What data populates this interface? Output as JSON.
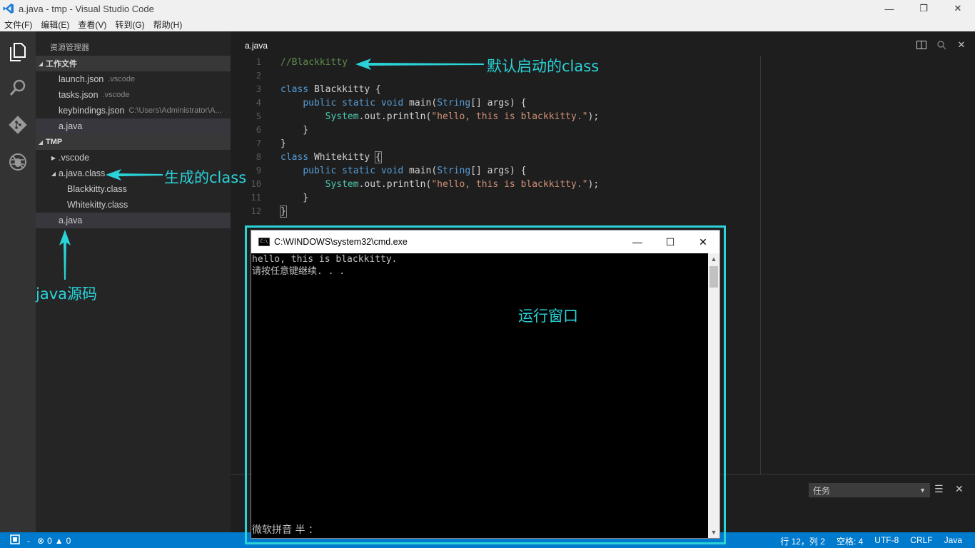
{
  "window": {
    "title": "a.java - tmp - Visual Studio Code",
    "controls": [
      "—",
      "❐",
      "✕"
    ]
  },
  "menu": [
    "文件(F)",
    "编辑(E)",
    "查看(V)",
    "转到(G)",
    "帮助(H)"
  ],
  "activity_icons": [
    "files-icon",
    "search-icon",
    "git-icon",
    "debug-icon"
  ],
  "sidebar": {
    "title": "资源管理器",
    "working_files_header": "工作文件",
    "working_files": [
      {
        "name": "launch.json",
        "detail": ".vscode"
      },
      {
        "name": "tasks.json",
        "detail": ".vscode"
      },
      {
        "name": "keybindings.json",
        "detail": "C:\\Users\\Administrator\\A..."
      },
      {
        "name": "a.java",
        "detail": ""
      }
    ],
    "folder_header": "TMP",
    "tree": [
      {
        "name": ".vscode",
        "level": 1,
        "twisty": "▶"
      },
      {
        "name": "a.java.class",
        "level": 1,
        "twisty": "◢"
      },
      {
        "name": "Blackkitty.class",
        "level": 2,
        "twisty": ""
      },
      {
        "name": "Whitekitty.class",
        "level": 2,
        "twisty": ""
      },
      {
        "name": "a.java",
        "level": 1,
        "twisty": ""
      }
    ]
  },
  "editor": {
    "tab": "a.java",
    "line_numbers": [
      "1",
      "2",
      "3",
      "4",
      "5",
      "6",
      "7",
      "8",
      "9",
      "10",
      "11",
      "12"
    ]
  },
  "panel": {
    "task_select": "任务",
    "select_arrow": "▼"
  },
  "statusbar": {
    "errors": "0",
    "warnings": "0",
    "position": "行 12，列 2",
    "indent": "空格: 4",
    "encoding": "UTF-8",
    "eol": "CRLF",
    "language": "Java"
  },
  "cmd": {
    "title": "C:\\WINDOWS\\system32\\cmd.exe",
    "icon_text": "C:\\",
    "lines": [
      "hello, this is blackkitty.",
      "请按任意键继续. . ."
    ],
    "ime": "微软拼音 半 ："
  },
  "annotations": {
    "default_class": "默认启动的class",
    "generated_class": "生成的class",
    "java_source": "java源码",
    "run_window": "运行窗口"
  },
  "colors": {
    "accent": "#007acc",
    "annotation": "#2ad3d8"
  }
}
